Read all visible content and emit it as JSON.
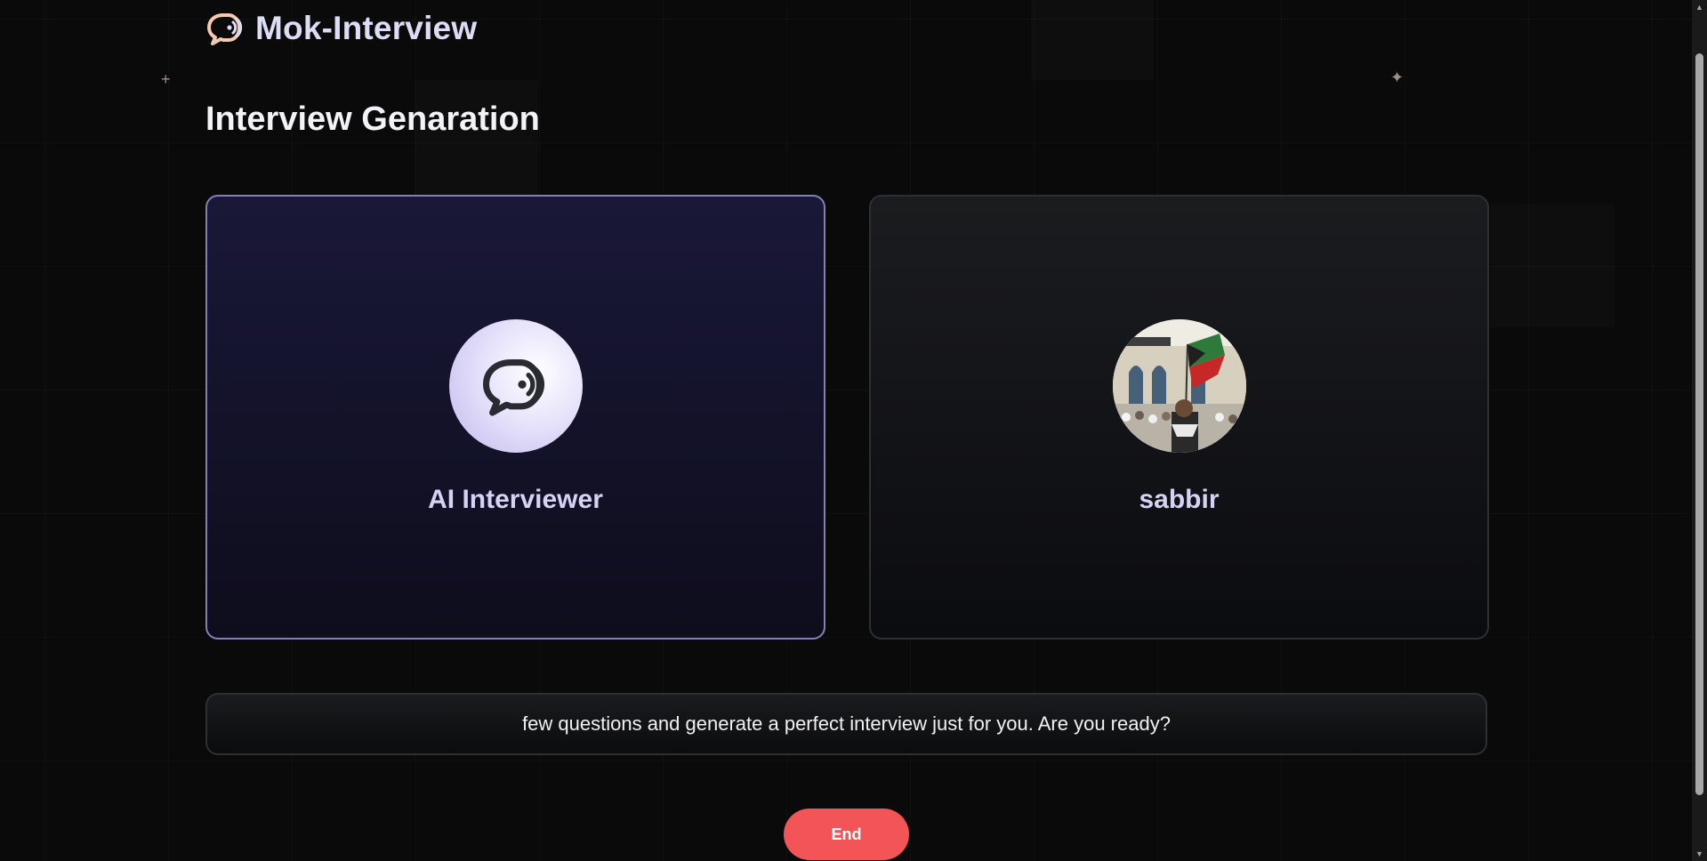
{
  "app": {
    "brand_name": "Mok-Interview",
    "brand_icon": "chat-bubble-sound-icon"
  },
  "page": {
    "title": "Interview Genaration"
  },
  "interviewer_card": {
    "name": "AI Interviewer",
    "icon": "chat-bubble-sound-icon"
  },
  "user_card": {
    "name": "sabbir",
    "avatar": "user-avatar-photo"
  },
  "transcript": {
    "text": "few questions and generate a perfect interview just for you. Are you ready?"
  },
  "controls": {
    "end_label": "End"
  },
  "colors": {
    "background": "#0a0a0b",
    "accent_end": "#f25457",
    "ai_card_border": "#8380b8",
    "brand_text": "#dcdcf5",
    "logo_accent": "#f4c9b0"
  }
}
